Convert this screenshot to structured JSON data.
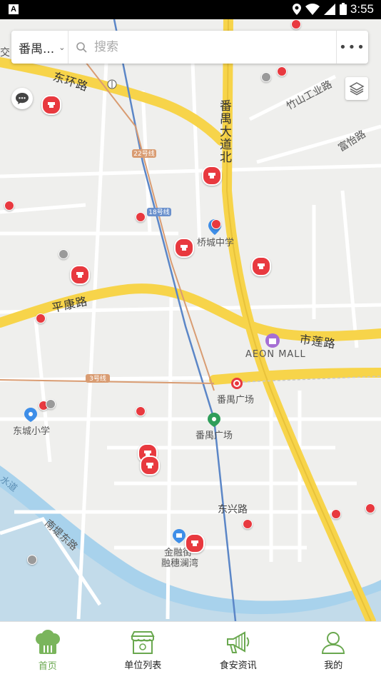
{
  "status_bar": {
    "time": "3:55"
  },
  "search": {
    "city": "番禺...",
    "placeholder": "搜索"
  },
  "map": {
    "roads": {
      "donghuan": "东环路",
      "panyu_dadao_bei": "番禺大道北",
      "pingkang": "平康路",
      "shilian": "市莲路",
      "zhushan": "竹山工业路",
      "fuyi": "富怡路",
      "dongxing": "东兴路",
      "nandi_dong": "南堤东路",
      "jiao": "交"
    },
    "places": {
      "qiaocheng": "桥城中学",
      "aeon": "AEON MALL",
      "panyu_square_station": "番禺广场",
      "panyu_square": "番禺广场",
      "dongcheng": "东城小学",
      "jinrong": "金融街",
      "rongsui": "融穗澜湾",
      "water": "水道"
    },
    "line_labels": {
      "l22": "22号线",
      "l18": "18号线",
      "l3": "3号线"
    }
  },
  "tabs": [
    {
      "label": "首页",
      "icon": "chef-hat-icon",
      "active": true
    },
    {
      "label": "单位列表",
      "icon": "store-icon",
      "active": false
    },
    {
      "label": "食安资讯",
      "icon": "megaphone-icon",
      "active": false
    },
    {
      "label": "我的",
      "icon": "user-icon",
      "active": false
    }
  ],
  "colors": {
    "accent": "#6aa84f",
    "marker": "#e8393f",
    "highway": "#f7d44a"
  }
}
